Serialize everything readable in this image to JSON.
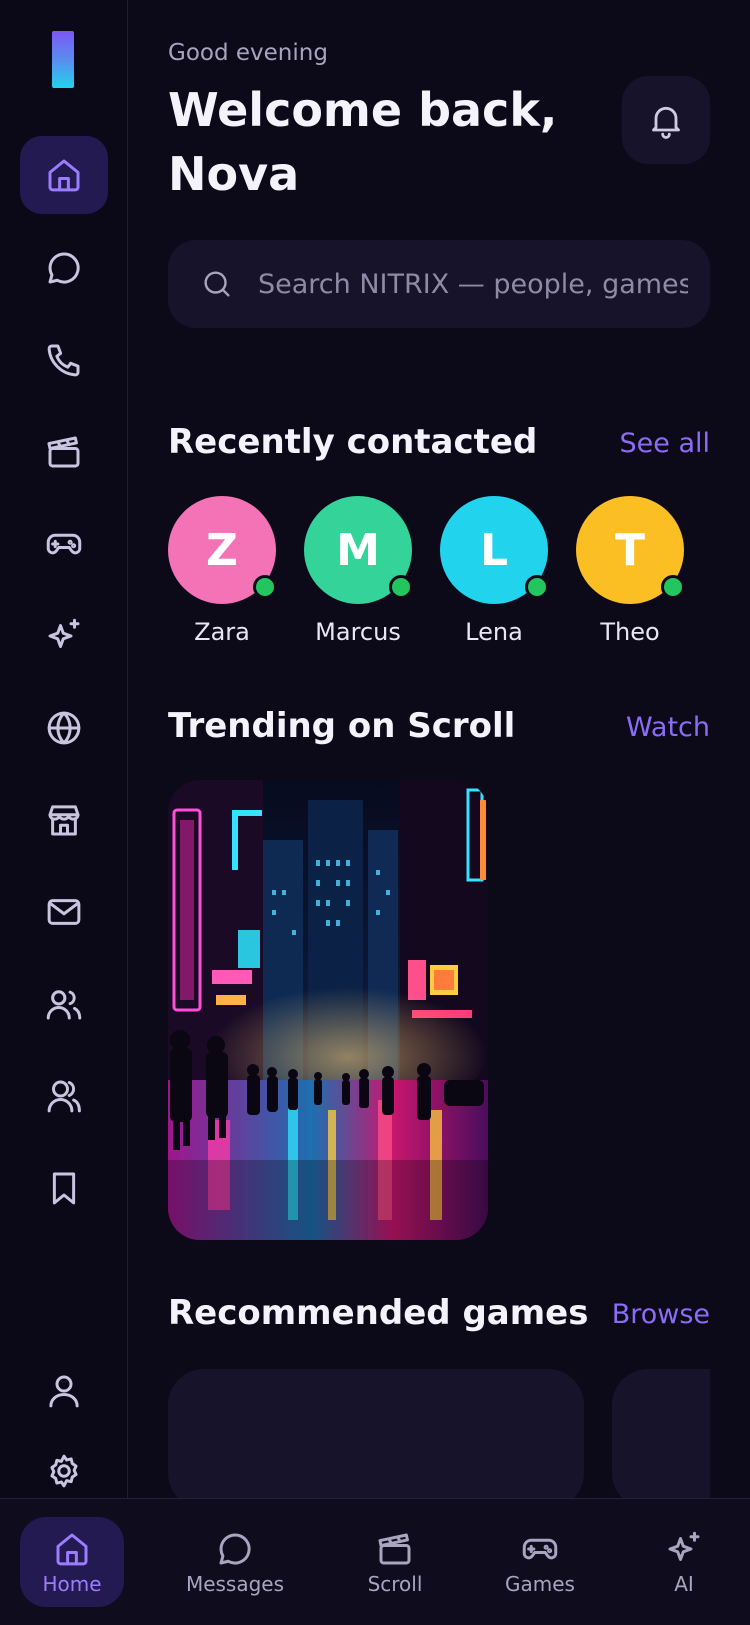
{
  "sidebar": {
    "items": [
      {
        "name": "home",
        "icon": "home-icon",
        "active": true
      },
      {
        "name": "messages",
        "icon": "chat-bubble-icon"
      },
      {
        "name": "calls",
        "icon": "phone-icon"
      },
      {
        "name": "scroll",
        "icon": "clapperboard-icon"
      },
      {
        "name": "games",
        "icon": "gamepad-icon"
      },
      {
        "name": "ai",
        "icon": "sparkle-icon"
      },
      {
        "name": "explore",
        "icon": "globe-icon"
      },
      {
        "name": "store",
        "icon": "storefront-icon"
      },
      {
        "name": "mail",
        "icon": "mail-icon"
      },
      {
        "name": "friends",
        "icon": "users-icon"
      },
      {
        "name": "groups",
        "icon": "group-icon"
      },
      {
        "name": "saved",
        "icon": "bookmark-icon"
      },
      {
        "name": "profile",
        "icon": "user-icon"
      },
      {
        "name": "settings",
        "icon": "gear-icon"
      }
    ]
  },
  "header": {
    "greeting": "Good evening",
    "welcome": "Welcome back, Nova"
  },
  "search": {
    "placeholder": "Search NITRIX — people, games, videos"
  },
  "recent": {
    "title": "Recently contacted",
    "link": "See all",
    "contacts": [
      {
        "initial": "Z",
        "name": "Zara",
        "color": "#f472b6",
        "online": true
      },
      {
        "initial": "M",
        "name": "Marcus",
        "color": "#34d399",
        "online": true
      },
      {
        "initial": "L",
        "name": "Lena",
        "color": "#22d3ee",
        "online": true
      },
      {
        "initial": "T",
        "name": "Theo",
        "color": "#fbbf24",
        "online": true
      }
    ]
  },
  "trending": {
    "title": "Trending on Scroll",
    "link": "Watch"
  },
  "games": {
    "title": "Recommended games",
    "link": "Browse"
  },
  "bottom_nav": {
    "items": [
      {
        "label": "Home",
        "icon": "home-icon",
        "active": true
      },
      {
        "label": "Messages",
        "icon": "chat-bubble-icon"
      },
      {
        "label": "Scroll",
        "icon": "clapperboard-icon"
      },
      {
        "label": "Games",
        "icon": "gamepad-icon"
      },
      {
        "label": "AI",
        "icon": "sparkle-icon"
      }
    ]
  },
  "colors": {
    "background": "#0c0a19",
    "surface": "#16132a",
    "accent": "#8b6cf6",
    "active_bg": "#241a52",
    "online": "#22c55e"
  }
}
